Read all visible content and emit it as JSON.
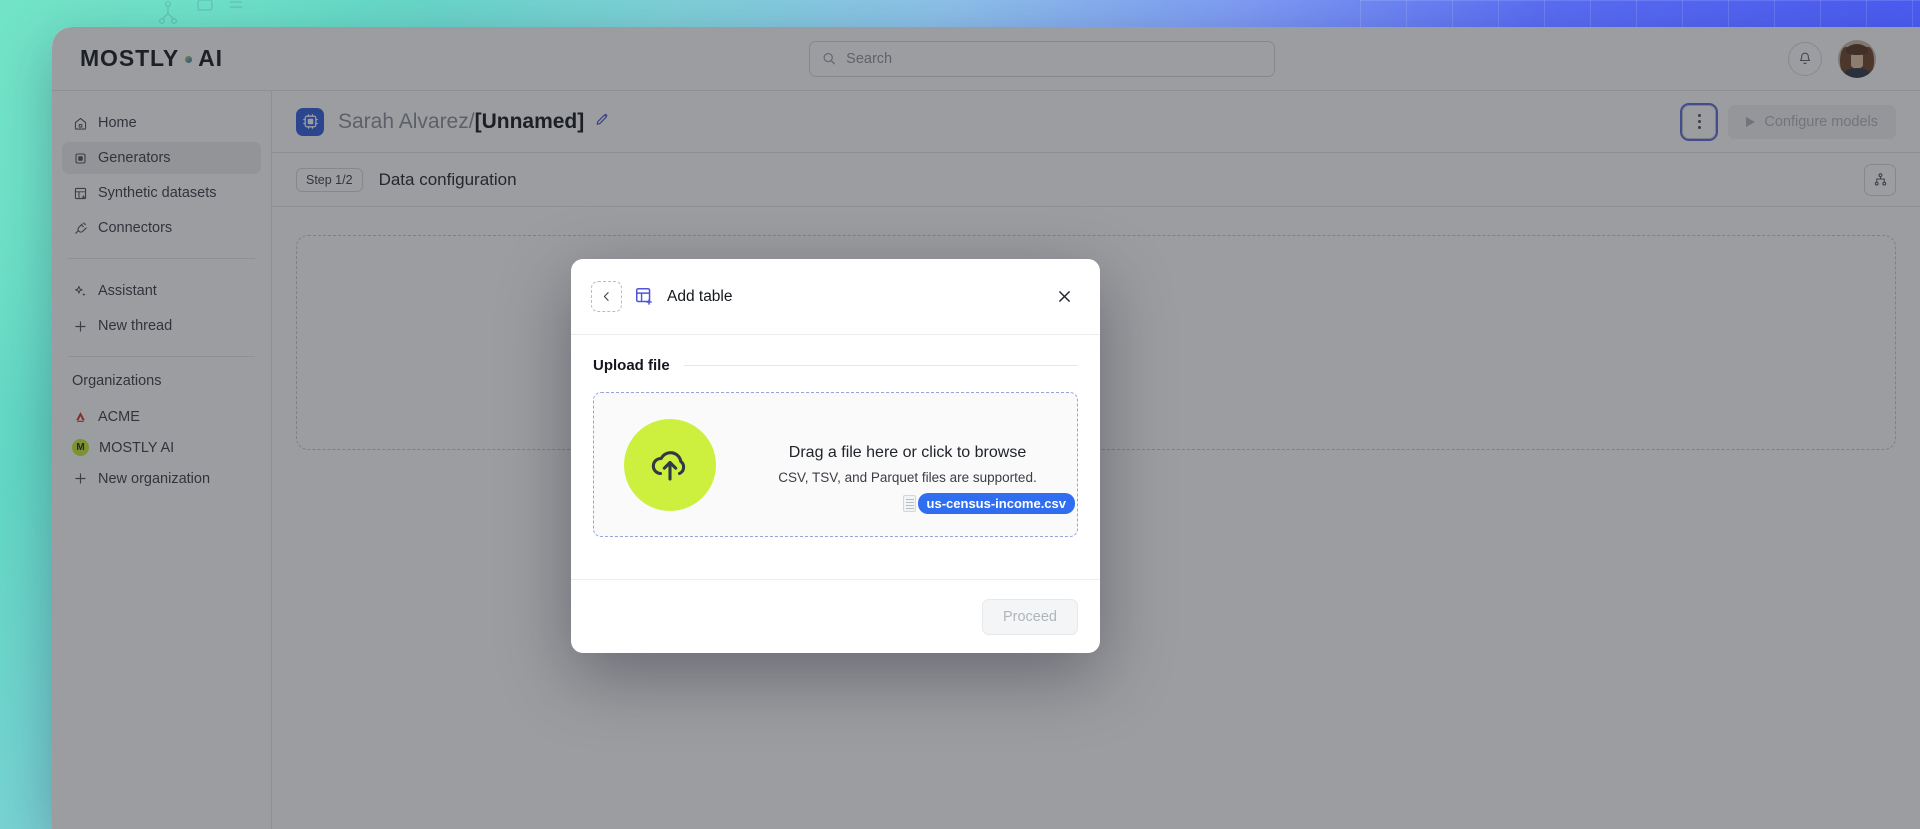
{
  "brand": {
    "logo_text_1": "MOSTLY",
    "logo_text_2": "AI",
    "accent_lime": "#cdf03f",
    "accent_blue": "#2f6ef0",
    "accent_indigo": "#4f56d6"
  },
  "topbar": {
    "search_placeholder": "Search",
    "search_value": "",
    "bell_icon": "bell-icon",
    "avatar_alt": "user-avatar"
  },
  "sidebar": {
    "items": [
      {
        "label": "Home",
        "icon": "home-icon",
        "active": false
      },
      {
        "label": "Generators",
        "icon": "ai-chip-icon",
        "active": true
      },
      {
        "label": "Synthetic datasets",
        "icon": "table-grid-icon",
        "active": false
      },
      {
        "label": "Connectors",
        "icon": "plug-icon",
        "active": false
      }
    ],
    "tools": [
      {
        "label": "Assistant",
        "icon": "sparkle-icon"
      },
      {
        "label": "New thread",
        "icon": "plus-icon"
      }
    ],
    "organizations_label": "Organizations",
    "organizations": [
      {
        "label": "ACME",
        "icon": "acme-triangle-icon"
      },
      {
        "label": "MOSTLY AI",
        "icon": "mostly-m-badge"
      }
    ],
    "new_organization_label": "New organization"
  },
  "page": {
    "icon": "ai-chip-icon",
    "owner": "Sarah Alvarez/",
    "name": "[Unnamed]",
    "edit_icon": "edit-pencil-icon",
    "kebab_icon": "more-vertical-icon",
    "configure_button": "Configure models",
    "configure_icon": "play-icon"
  },
  "step_bar": {
    "badge": "Step 1/2",
    "title": "Data configuration",
    "right_icon": "hierarchy-icon"
  },
  "canvas": {
    "hint": ""
  },
  "modal": {
    "back_icon": "chevron-left-icon",
    "title_icon": "table-plus-icon",
    "title": "Add table",
    "close_icon": "close-icon",
    "section_title": "Upload file",
    "dropzone": {
      "icon": "cloud-upload-icon",
      "primary": "Drag a file here or click to browse",
      "secondary": "CSV, TSV, and Parquet files are supported."
    },
    "drag_chip": {
      "icon": "file-document-icon",
      "filename": "us-census-income.csv"
    },
    "proceed_button": "Proceed"
  }
}
